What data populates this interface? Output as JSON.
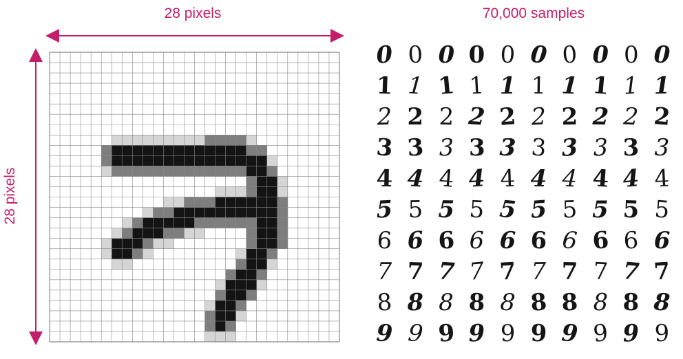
{
  "labels": {
    "width": "28 pixels",
    "height": "28 pixels",
    "samples": "70,000 samples"
  },
  "colors": {
    "accent": "#c41e6a",
    "grid": "#888888",
    "ink": "#151515"
  },
  "grid": {
    "cols": 28,
    "rows": 28,
    "digit_label": "7"
  },
  "samples": {
    "rows": [
      [
        "0",
        "0",
        "0",
        "0",
        "0",
        "0",
        "0",
        "0",
        "0",
        "0"
      ],
      [
        "1",
        "1",
        "1",
        "1",
        "1",
        "1",
        "1",
        "1",
        "1",
        "1"
      ],
      [
        "2",
        "2",
        "2",
        "2",
        "2",
        "2",
        "2",
        "2",
        "2",
        "2"
      ],
      [
        "3",
        "3",
        "3",
        "3",
        "3",
        "3",
        "3",
        "3",
        "3",
        "3"
      ],
      [
        "4",
        "4",
        "4",
        "4",
        "4",
        "4",
        "4",
        "4",
        "4",
        "4"
      ],
      [
        "5",
        "5",
        "5",
        "5",
        "5",
        "5",
        "5",
        "5",
        "5",
        "5"
      ],
      [
        "6",
        "6",
        "6",
        "6",
        "6",
        "6",
        "6",
        "6",
        "6",
        "6"
      ],
      [
        "7",
        "7",
        "7",
        "7",
        "7",
        "7",
        "7",
        "7",
        "7",
        "7"
      ],
      [
        "8",
        "8",
        "8",
        "8",
        "8",
        "8",
        "8",
        "8",
        "8",
        "8"
      ],
      [
        "9",
        "9",
        "9",
        "9",
        "9",
        "9",
        "9",
        "9",
        "9",
        "9"
      ]
    ]
  }
}
